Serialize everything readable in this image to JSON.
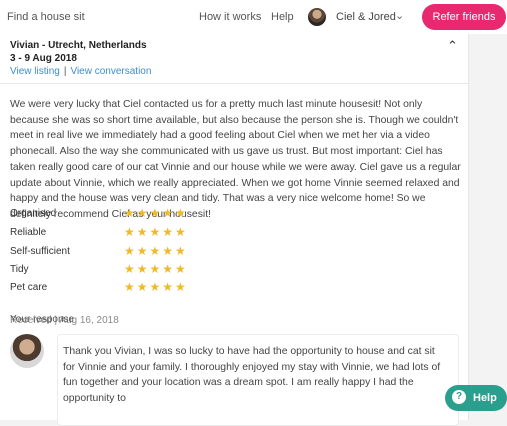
{
  "nav": {
    "find_label": "Find a house sit",
    "how_label": "How it works",
    "help_label": "Help",
    "user_name": "Ciel & Jored",
    "refer_label": "Refer friends"
  },
  "review": {
    "name": "Vivian - Utrecht, Netherlands",
    "dates": "3 - 9 Aug 2018",
    "view_listing": "View listing",
    "separator": "|",
    "view_conversation": "View conversation",
    "text": "We were very lucky that Ciel contacted us for a pretty much last minute housesit! Not only because she was so short time available, but also because the person she is. Though we couldn't meet in real live we immediately had a good feeling about Ciel when we met her via a video phonecall. Also the way she communicated with us gave us trust. But most important: Ciel has taken really good care of our cat Vinnie and our house while we were away. Ciel gave us a regular update about Vinnie, which we really appreciated. When we got home Vinnie seemed relaxed and happy and the house was very clean and tidy. That was a very nice welcome home! So we definitely recommend Ciel as your housesit!",
    "ratings": [
      {
        "label": "Organised",
        "value": 5,
        "stars": "★★★★★"
      },
      {
        "label": "Reliable",
        "value": 5,
        "stars": "★★★★★"
      },
      {
        "label": "Self-sufficient",
        "value": 5,
        "stars": "★★★★★"
      },
      {
        "label": "Tidy",
        "value": 5,
        "stars": "★★★★★"
      },
      {
        "label": "Pet care",
        "value": 5,
        "stars": "★★★★★"
      }
    ],
    "received": "Received | Aug 16, 2018"
  },
  "response": {
    "title": "Your response",
    "text": "Thank you Vivian, I was so lucky to have had the opportunity to house and cat sit for Vinnie and your family. I thoroughly enjoyed my stay with Vinnie, we had lots of fun together and your location was a dream spot. I am really happy I had the opportunity to"
  },
  "help_widget": {
    "label": "Help",
    "icon_glyph": "?"
  },
  "icons": {
    "collapse": "chevron-up-icon",
    "user_menu": "chevron-down-icon",
    "star": "star-icon"
  },
  "colors": {
    "brand_pink": "#e8286f",
    "link_blue": "#3d8ec9",
    "star_gold": "#f0b92d",
    "help_teal": "#2b9f8e"
  }
}
